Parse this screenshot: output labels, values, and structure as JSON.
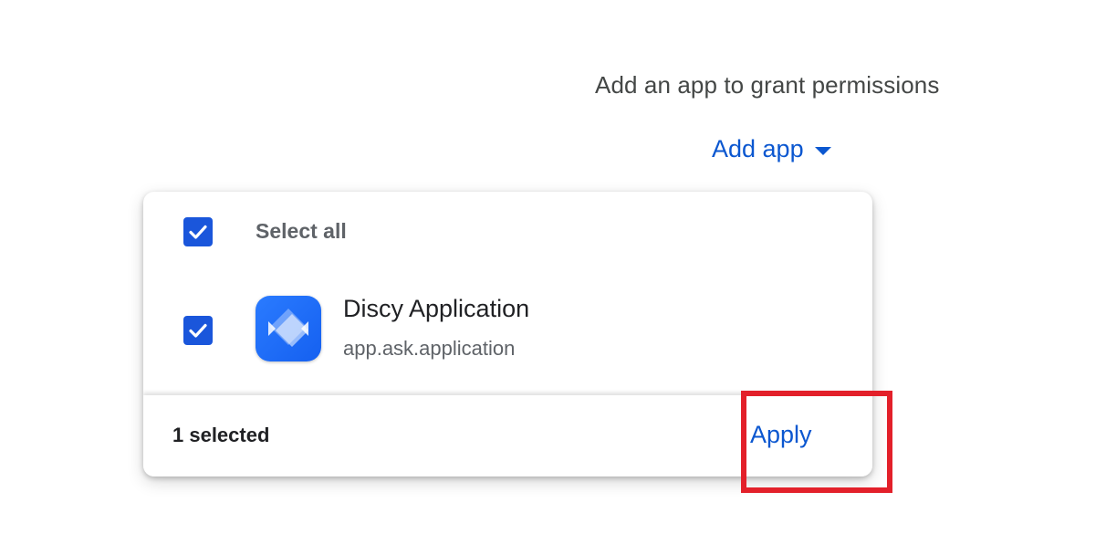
{
  "heading": "Add an app to grant permissions",
  "add_app": {
    "label": "Add app",
    "caret_icon": "caret-down-icon"
  },
  "panel": {
    "select_all": {
      "label": "Select all",
      "checked": true
    },
    "apps": [
      {
        "name": "Discy Application",
        "id": "app.ask.application",
        "icon": "discy-app-icon",
        "checked": true
      }
    ],
    "footer": {
      "selected_count": "1 selected",
      "apply_label": "Apply"
    }
  },
  "colors": {
    "accent": "#0b57d0",
    "checkbox": "#1a56db",
    "highlight": "#e3202a",
    "app_icon": "#1a6bf5"
  }
}
